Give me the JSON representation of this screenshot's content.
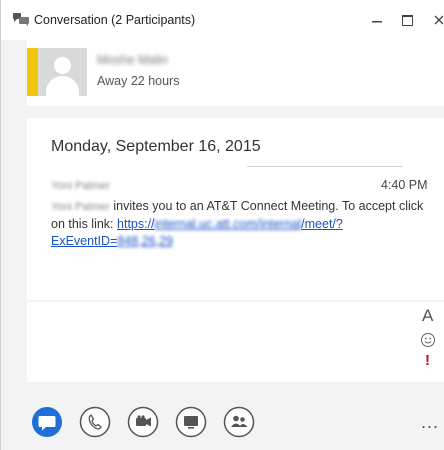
{
  "window": {
    "title": "Conversation (2 Participants)"
  },
  "contact": {
    "name": "Moshe Malin",
    "status": "Away 22 hours",
    "presence_color": "#f1c40f"
  },
  "conversation": {
    "date": "Monday, September 16, 2015",
    "sender": "Yoni Palmer",
    "time": "4:40 PM",
    "message": {
      "sender": "Yoni Palmer",
      "text": " invites you to an AT&T Connect Meeting. To accept click on this link: ",
      "link_prefix": "https://",
      "link_host": "internal.uc.att.com/internal",
      "link_path": "/meet/?",
      "link_param": "ExEventID=",
      "link_id": "848,26,29"
    }
  },
  "compose": {
    "font_button": "A",
    "emoticon_icon": "smiley-icon",
    "importance_mark": "!"
  },
  "toolbar": {
    "more_label": "...",
    "accent_color": "#1e6fd6",
    "buttons": [
      "im-icon",
      "phone-icon",
      "video-icon",
      "present-icon",
      "participants-icon"
    ]
  }
}
